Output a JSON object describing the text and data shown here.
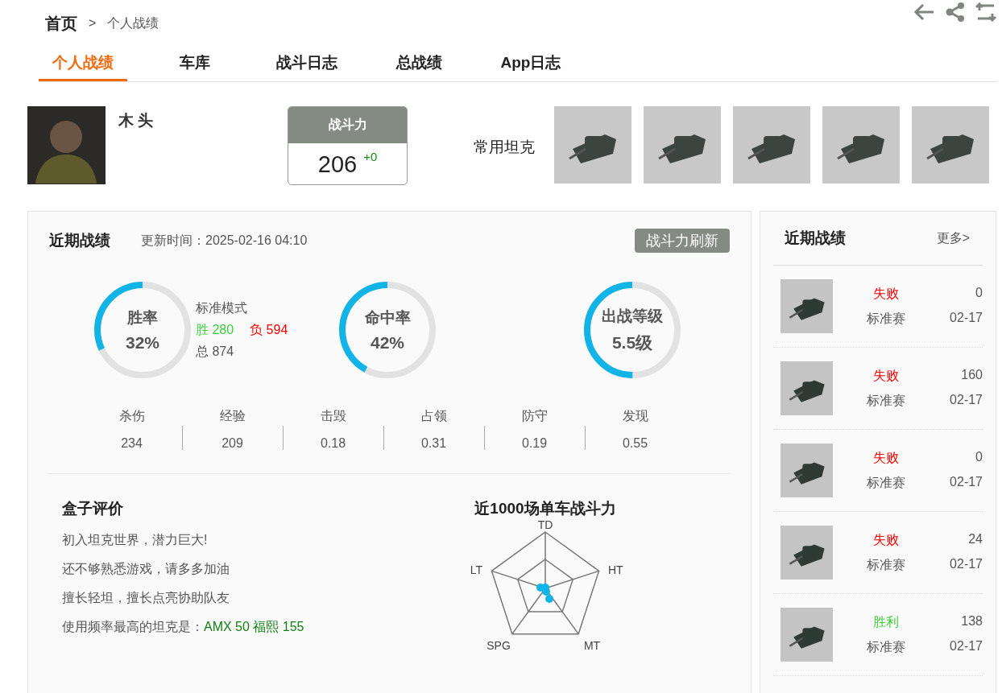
{
  "breadcrumb": {
    "home": "首页",
    "separator": ">",
    "current": "个人战绩"
  },
  "tabs": [
    {
      "label": "个人战绩",
      "selected": true
    },
    {
      "label": "车库",
      "selected": false
    },
    {
      "label": "战斗日志",
      "selected": false
    },
    {
      "label": "总战绩",
      "selected": false
    },
    {
      "label": "App日志",
      "selected": false
    }
  ],
  "profile": {
    "name": "木 头",
    "power": {
      "title": "战斗力",
      "value": "206",
      "change": "+0"
    },
    "tanks_label": "常用坦克"
  },
  "recent": {
    "title": "近期战绩",
    "updated": "更新时间：2025-02-16 04:10",
    "refresh_button": "战斗力刷新",
    "rings": [
      {
        "label": "胜率",
        "value": "32%",
        "level": 0.32
      },
      {
        "label": "命中率",
        "value": "42%",
        "level": 0.42
      },
      {
        "label": "出战等级",
        "value": "5.5级",
        "level": 0.5
      }
    ],
    "mode": {
      "title": "标准模式",
      "wins_label": "胜",
      "wins": "280",
      "losses_label": "负",
      "losses": "594",
      "total_label": "总",
      "total": "874"
    },
    "stats": [
      {
        "label": "杀伤",
        "value": "234"
      },
      {
        "label": "经验",
        "value": "209"
      },
      {
        "label": "击毁",
        "value": "0.18"
      },
      {
        "label": "占领",
        "value": "0.31"
      },
      {
        "label": "防守",
        "value": "0.19"
      },
      {
        "label": "发现",
        "value": "0.55"
      }
    ]
  },
  "evaluation": {
    "title": "盒子评价",
    "lines": [
      "初入坦克世界，潜力巨大!",
      "还不够熟悉游戏，请多多加油",
      "擅长轻坦，擅长点亮协助队友"
    ],
    "favorite_label": "使用频率最高的坦克是：",
    "favorite_tank": "AMX 50 福熙 155"
  },
  "radar": {
    "title": "近1000场单车战斗力",
    "axes": [
      "TD",
      "HT",
      "MT",
      "SPG",
      "LT"
    ]
  },
  "sidebar": {
    "title": "近期战绩",
    "more_link": "更多>",
    "battles": [
      {
        "result": "失败",
        "won": false,
        "score": "0",
        "mode": "标准赛",
        "date": "02-17"
      },
      {
        "result": "失败",
        "won": false,
        "score": "160",
        "mode": "标准赛",
        "date": "02-17"
      },
      {
        "result": "失败",
        "won": false,
        "score": "0",
        "mode": "标准赛",
        "date": "02-17"
      },
      {
        "result": "失败",
        "won": false,
        "score": "24",
        "mode": "标准赛",
        "date": "02-17"
      },
      {
        "result": "胜利",
        "won": true,
        "score": "138",
        "mode": "标准赛",
        "date": "02-17"
      }
    ]
  }
}
